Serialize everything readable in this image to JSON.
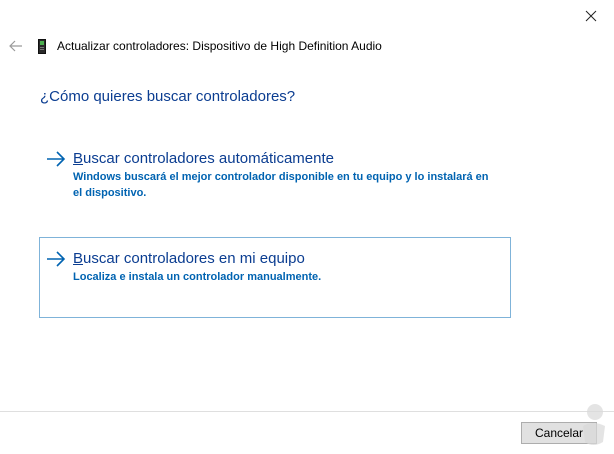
{
  "window": {
    "title": "Actualizar controladores: Dispositivo de High Definition Audio",
    "close_icon": "close-icon",
    "back_icon": "back-arrow-icon",
    "device_icon": "audio-device-icon"
  },
  "main": {
    "question": "¿Cómo quieres buscar controladores?",
    "options": [
      {
        "mnemonic": "B",
        "title_rest": "uscar controladores automáticamente",
        "description": "Windows buscará el mejor controlador disponible en tu equipo y lo instalará en el dispositivo.",
        "icon": "arrow-right-icon"
      },
      {
        "mnemonic": "B",
        "title_rest": "uscar controladores en mi equipo",
        "description": "Localiza e instala un controlador manualmente.",
        "icon": "arrow-right-icon",
        "focused": true
      }
    ]
  },
  "footer": {
    "cancel_label": "Cancelar"
  },
  "colors": {
    "link": "#0b3d91",
    "description": "#0063b1",
    "focus_border": "#7fb3d9"
  }
}
